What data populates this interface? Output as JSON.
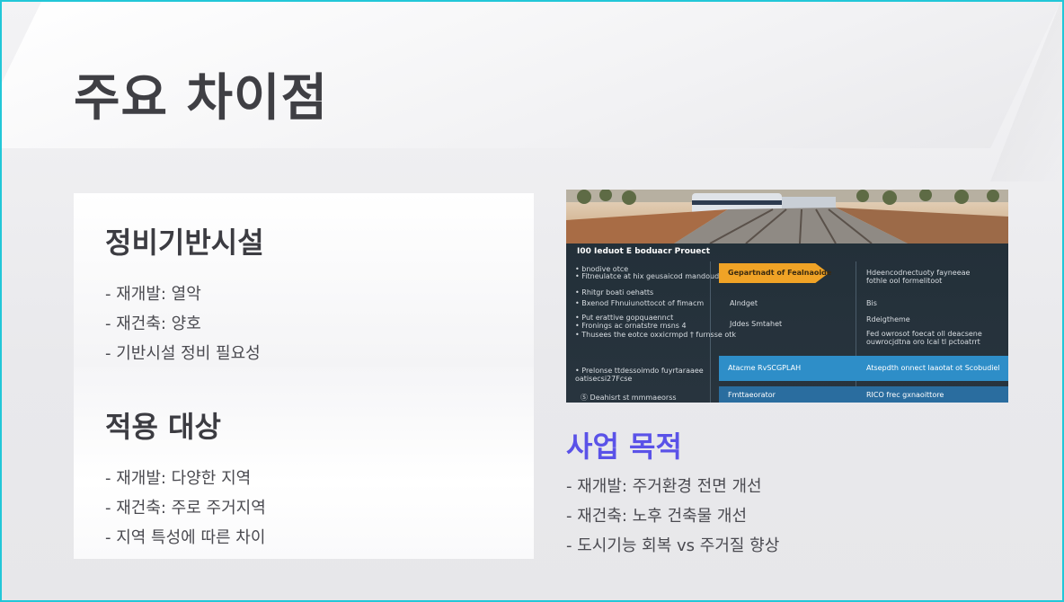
{
  "title": "주요 차이점",
  "cards": [
    {
      "title": "정비기반시설",
      "bullets": [
        "- 재개발: 열악",
        "- 재건축: 양호",
        "- 기반시설 정비 필요성"
      ]
    },
    {
      "title": "적용 대상",
      "bullets": [
        "- 재개발: 다양한 지역",
        "- 재건축: 주로 주거지역",
        "- 지역 특성에 따른 차이"
      ]
    }
  ],
  "purpose": {
    "title": "사업 목적",
    "bullets": [
      "- 재개발: 주거환경 전면 개선",
      "- 재건축: 노후 건축물 개선",
      "- 도시기능 회복 vs 주거질 향상"
    ]
  },
  "image": {
    "header": "I00 Ieduot E boduacr Prouect",
    "left_lines": [
      "• bnodive otce",
      "• Fitneulatce at hix geusaicod mandoudling",
      "• Rhitgr boati oehatts",
      "• Bxenod Fhnuiunottocot of fimacm",
      "• Put erattive gopquaennct",
      "• Fronings ac ornatstre rnsns  4",
      "• Thusees the eotce oxxicrmpd † furnsse otk",
      "• Prelonse ttdessoimdo fuyrtaraaee",
      "  oatisecsi27Fcse",
      "Ⓢ Deahisrt st mmmaeorss"
    ],
    "middle_lines": [
      "Gepartnadt of Fealnaoide",
      "Alndget",
      "Jddes Smtahet",
      "Atacme RvSCGPLAH",
      "Fmttaeorator"
    ],
    "right_lines": [
      "Hdeencodnectuoty fayneeae",
      "fothle ool formelitoot",
      "Bis",
      "Rdeigtheme",
      "Fed owrosot foecat oll deacsene",
      "ouwrocjdtna oro Ical tl pctoatrrt",
      "Atsepdth onnect laaotat ot Scobudiel",
      "RICO frec gxnaoittore"
    ],
    "colors": {
      "orange": "#f0a326",
      "blue": "#2e8ec8",
      "dark_blue": "#2a6d9f",
      "panel": "#25323d"
    }
  },
  "colors": {
    "accent": "#5a52e8",
    "border": "#22c7d8",
    "title": "#3f3f44"
  }
}
